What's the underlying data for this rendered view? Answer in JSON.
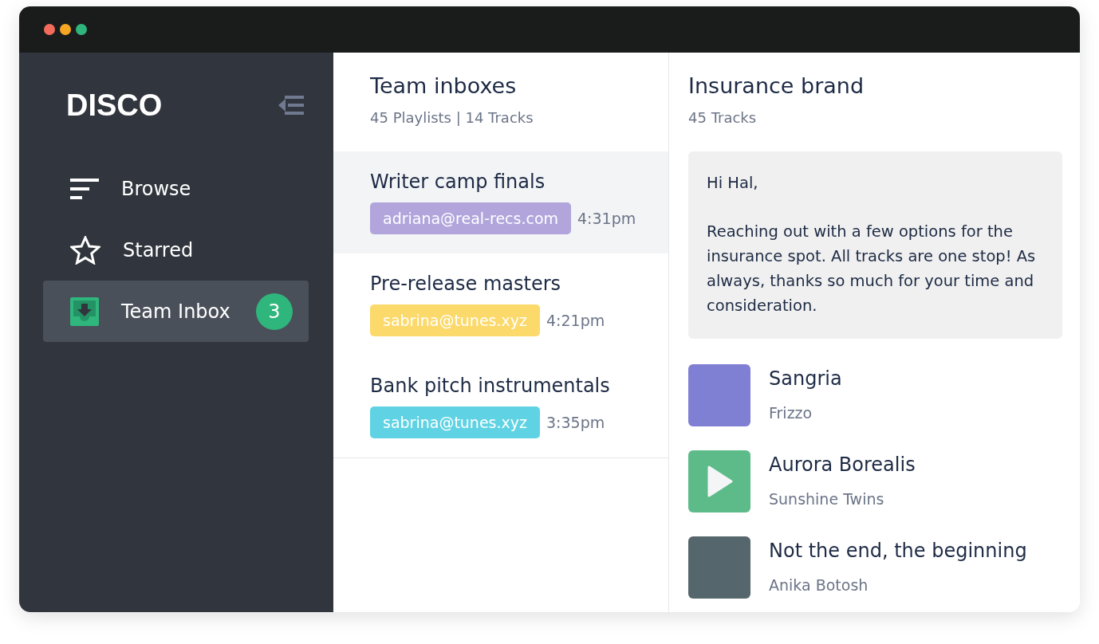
{
  "window": {
    "controls": [
      {
        "color": "#f26b5b"
      },
      {
        "color": "#f5a623"
      },
      {
        "color": "#2fb67c"
      }
    ]
  },
  "sidebar": {
    "logo": "DISCO",
    "items": [
      {
        "kind": "browse",
        "label": "Browse",
        "selected": false
      },
      {
        "kind": "starred",
        "label": "Starred",
        "selected": false
      },
      {
        "kind": "inbox",
        "label": "Team Inbox",
        "selected": true,
        "badge": "3"
      }
    ]
  },
  "inboxes": {
    "title": "Team inboxes",
    "subtitle": "45 Playlists | 14 Tracks",
    "items": [
      {
        "title": "Writer camp finals",
        "sender": "adriana@real-recs.com",
        "color": "#b1a5dc",
        "time": "4:31pm",
        "selected": true
      },
      {
        "title": "Pre-release masters",
        "sender": "sabrina@tunes.xyz",
        "color": "#fbd96a",
        "time": "4:21pm",
        "selected": false
      },
      {
        "title": "Bank pitch instrumentals",
        "sender": "sabrina@tunes.xyz",
        "color": "#5fd3e3",
        "time": "3:35pm",
        "selected": false
      }
    ]
  },
  "detail": {
    "title": "Insurance brand",
    "subtitle": "45 Tracks",
    "message": [
      "Hi Hal,",
      "Reaching out with a few options for the insurance spot. All tracks are one stop! As always, thanks so much for your time and consideration."
    ],
    "tracks": [
      {
        "title": "Sangria",
        "artist": "Frizzo",
        "playing": false
      },
      {
        "title": "Aurora Borealis",
        "artist": "Sunshine Twins",
        "playing": true
      },
      {
        "title": "Not the end, the beginning",
        "artist": "Anika Botosh",
        "playing": false
      }
    ]
  }
}
